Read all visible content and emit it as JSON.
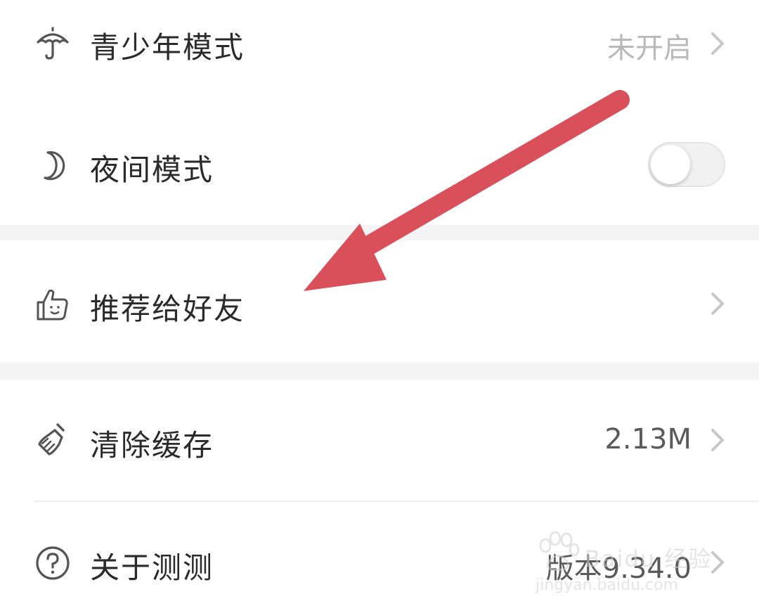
{
  "settings": {
    "items": [
      {
        "label": "青少年模式",
        "value": "未开启",
        "icon": "umbrella-icon"
      },
      {
        "label": "夜间模式",
        "toggle_on": false,
        "icon": "moon-icon"
      },
      {
        "label": "推荐给好友",
        "icon": "thumbs-up-icon"
      },
      {
        "label": "清除缓存",
        "value": "2.13M",
        "icon": "broom-icon"
      },
      {
        "label": "关于测测",
        "value": "版本9.34.0",
        "icon": "question-icon"
      }
    ]
  },
  "annotation": {
    "color": "#d9505a"
  },
  "watermark": {
    "title": "Baidu 经验",
    "url": "jingyan.baidu.com"
  }
}
